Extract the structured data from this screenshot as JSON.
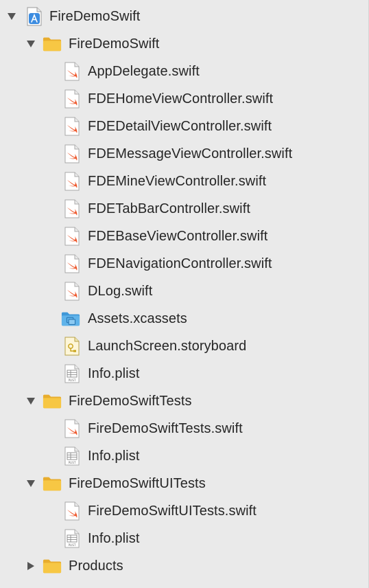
{
  "navigator": {
    "rows": [
      {
        "label": "FireDemoSwift",
        "icon": "xcode-project-icon",
        "level": 0,
        "disclosure": "expanded"
      },
      {
        "label": "FireDemoSwift",
        "icon": "folder-icon",
        "level": 1,
        "disclosure": "expanded"
      },
      {
        "label": "AppDelegate.swift",
        "icon": "swift-file-icon",
        "level": 2,
        "disclosure": "none"
      },
      {
        "label": "FDEHomeViewController.swift",
        "icon": "swift-file-icon",
        "level": 2,
        "disclosure": "none"
      },
      {
        "label": "FDEDetailViewController.swift",
        "icon": "swift-file-icon",
        "level": 2,
        "disclosure": "none"
      },
      {
        "label": "FDEMessageViewController.swift",
        "icon": "swift-file-icon",
        "level": 2,
        "disclosure": "none"
      },
      {
        "label": "FDEMineViewController.swift",
        "icon": "swift-file-icon",
        "level": 2,
        "disclosure": "none"
      },
      {
        "label": "FDETabBarController.swift",
        "icon": "swift-file-icon",
        "level": 2,
        "disclosure": "none"
      },
      {
        "label": "FDEBaseViewController.swift",
        "icon": "swift-file-icon",
        "level": 2,
        "disclosure": "none"
      },
      {
        "label": "FDENavigationController.swift",
        "icon": "swift-file-icon",
        "level": 2,
        "disclosure": "none"
      },
      {
        "label": "DLog.swift",
        "icon": "swift-file-icon",
        "level": 2,
        "disclosure": "none"
      },
      {
        "label": "Assets.xcassets",
        "icon": "asset-catalog-folder-icon",
        "level": 2,
        "disclosure": "none"
      },
      {
        "label": "LaunchScreen.storyboard",
        "icon": "storyboard-file-icon",
        "level": 2,
        "disclosure": "none"
      },
      {
        "label": "Info.plist",
        "icon": "plist-file-icon",
        "level": 2,
        "disclosure": "none"
      },
      {
        "label": "FireDemoSwiftTests",
        "icon": "folder-icon",
        "level": 1,
        "disclosure": "expanded"
      },
      {
        "label": "FireDemoSwiftTests.swift",
        "icon": "swift-file-icon",
        "level": 2,
        "disclosure": "none"
      },
      {
        "label": "Info.plist",
        "icon": "plist-file-icon",
        "level": 2,
        "disclosure": "none"
      },
      {
        "label": "FireDemoSwiftUITests",
        "icon": "folder-icon",
        "level": 1,
        "disclosure": "expanded"
      },
      {
        "label": "FireDemoSwiftUITests.swift",
        "icon": "swift-file-icon",
        "level": 2,
        "disclosure": "none"
      },
      {
        "label": "Info.plist",
        "icon": "plist-file-icon",
        "level": 2,
        "disclosure": "none"
      },
      {
        "label": "Products",
        "icon": "folder-icon",
        "level": 1,
        "disclosure": "collapsed"
      }
    ]
  },
  "colors": {
    "background": "#eaeaea",
    "text": "#262626",
    "disclosure": "#555555",
    "folder_yellow": "#f7c744",
    "swift_orange": "#ee5a2f",
    "asset_blue": "#5fb3ea",
    "project_blue": "#3c8ce0"
  },
  "plist_badge": "PLIST"
}
